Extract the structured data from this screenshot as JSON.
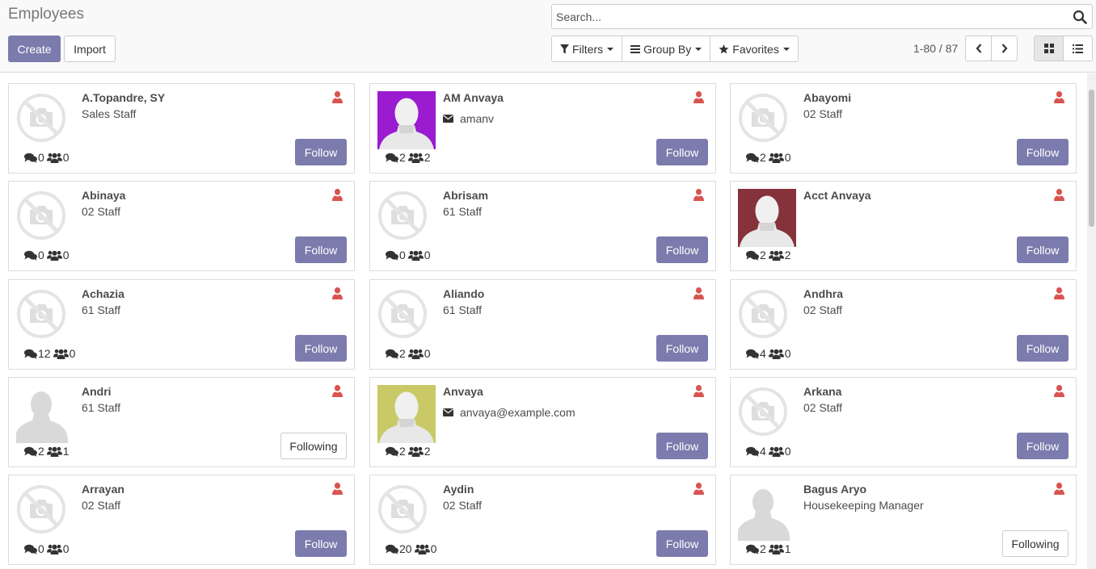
{
  "header": {
    "title": "Employees",
    "create_label": "Create",
    "import_label": "Import"
  },
  "search": {
    "placeholder": "Search...",
    "value": ""
  },
  "search_options": {
    "filters_label": "Filters",
    "group_by_label": "Group By",
    "favorites_label": "Favorites"
  },
  "pager": {
    "value": "1-80 / 87"
  },
  "colors": {
    "primary": "#7c7bad",
    "presence": "#d9534f",
    "avatar_purple": "#9a1bd0",
    "avatar_maroon": "#86323a",
    "avatar_olive": "#c9c967"
  },
  "employees": [
    {
      "name": "A.Topandre, SY",
      "job": "Sales Staff",
      "email": "",
      "image": "placeholder",
      "messages": "0",
      "followers": "0",
      "follow_label": "Follow",
      "following": false
    },
    {
      "name": "AM Anvaya",
      "job": "",
      "email": "amanv",
      "image": "avatar-purple",
      "messages": "2",
      "followers": "2",
      "follow_label": "Follow",
      "following": false
    },
    {
      "name": "Abayomi",
      "job": "02 Staff",
      "email": "",
      "image": "placeholder",
      "messages": "2",
      "followers": "0",
      "follow_label": "Follow",
      "following": false
    },
    {
      "name": "Abinaya",
      "job": "02 Staff",
      "email": "",
      "image": "placeholder",
      "messages": "0",
      "followers": "0",
      "follow_label": "Follow",
      "following": false
    },
    {
      "name": "Abrisam",
      "job": "61 Staff",
      "email": "",
      "image": "placeholder",
      "messages": "0",
      "followers": "0",
      "follow_label": "Follow",
      "following": false
    },
    {
      "name": "Acct Anvaya",
      "job": "",
      "email": "",
      "image": "avatar-maroon",
      "messages": "2",
      "followers": "2",
      "follow_label": "Follow",
      "following": false
    },
    {
      "name": "Achazia",
      "job": "61 Staff",
      "email": "",
      "image": "placeholder",
      "messages": "12",
      "followers": "0",
      "follow_label": "Follow",
      "following": false
    },
    {
      "name": "Aliando",
      "job": "61 Staff",
      "email": "",
      "image": "placeholder",
      "messages": "2",
      "followers": "0",
      "follow_label": "Follow",
      "following": false
    },
    {
      "name": "Andhra",
      "job": "02 Staff",
      "email": "",
      "image": "placeholder",
      "messages": "4",
      "followers": "0",
      "follow_label": "Follow",
      "following": false
    },
    {
      "name": "Andri",
      "job": "61 Staff",
      "email": "",
      "image": "silhouette",
      "messages": "2",
      "followers": "1",
      "follow_label": "Following",
      "following": true
    },
    {
      "name": "Anvaya",
      "job": "",
      "email": "anvaya@example.com",
      "image": "avatar-olive",
      "messages": "2",
      "followers": "2",
      "follow_label": "Follow",
      "following": false
    },
    {
      "name": "Arkana",
      "job": "02 Staff",
      "email": "",
      "image": "placeholder",
      "messages": "4",
      "followers": "0",
      "follow_label": "Follow",
      "following": false
    },
    {
      "name": "Arrayan",
      "job": "02 Staff",
      "email": "",
      "image": "placeholder",
      "messages": "0",
      "followers": "0",
      "follow_label": "Follow",
      "following": false
    },
    {
      "name": "Aydin",
      "job": "02 Staff",
      "email": "",
      "image": "placeholder",
      "messages": "20",
      "followers": "0",
      "follow_label": "Follow",
      "following": false
    },
    {
      "name": "Bagus Aryo",
      "job": "Housekeeping Manager",
      "email": "",
      "image": "silhouette",
      "messages": "2",
      "followers": "1",
      "follow_label": "Following",
      "following": true
    }
  ]
}
